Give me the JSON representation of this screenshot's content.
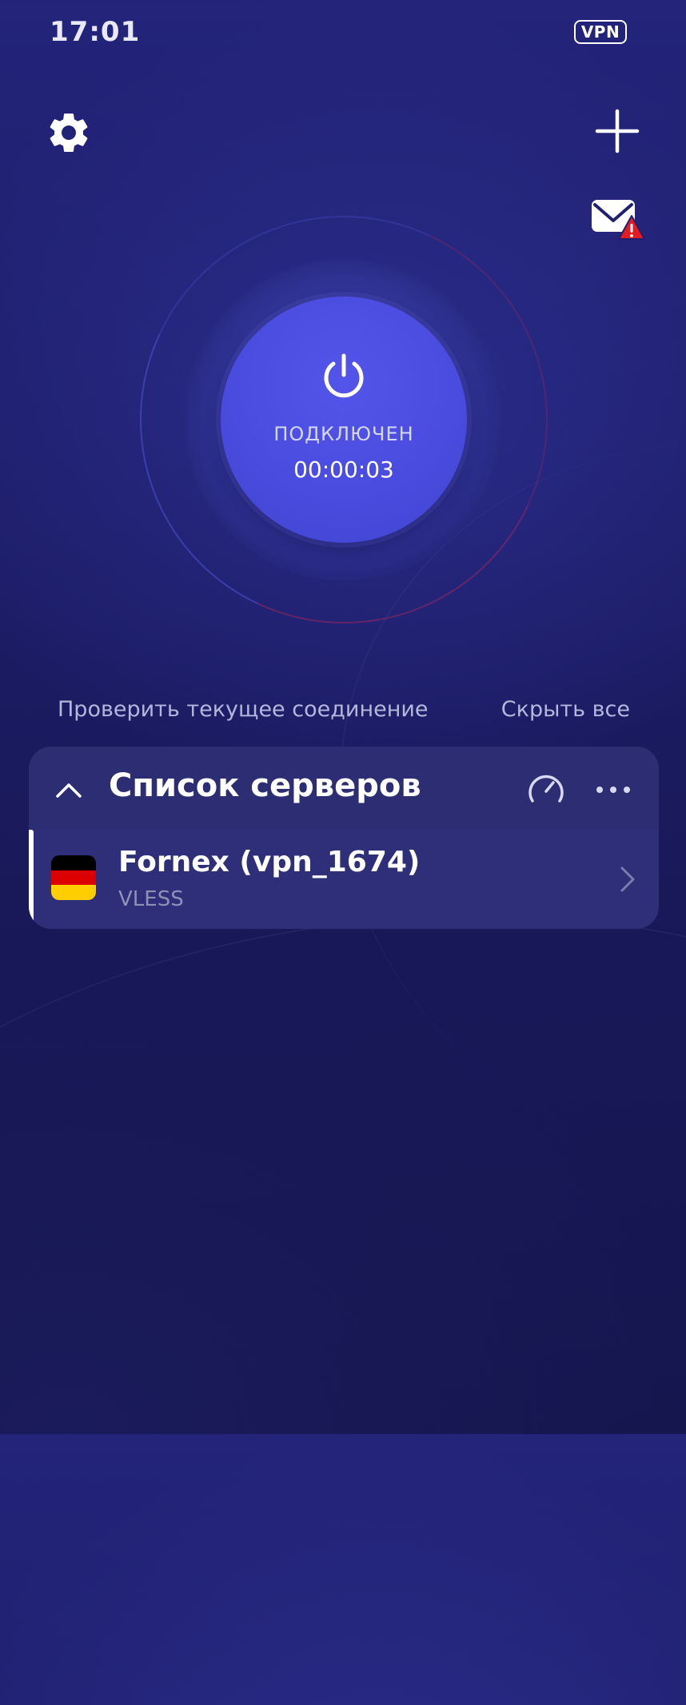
{
  "status_bar": {
    "time": "17:01",
    "vpn_badge": "VPN"
  },
  "toolbar": {
    "settings_icon": "gear-icon",
    "add_icon": "plus-icon",
    "mail_icon": "mail-alert-icon"
  },
  "connection": {
    "status": "ПОДКЛЮЧЕН",
    "timer": "00:00:03"
  },
  "links": {
    "check_connection": "Проверить текущее соединение",
    "hide_all": "Скрыть все"
  },
  "server_list": {
    "title": "Список серверов",
    "servers": [
      {
        "name": "Fornex (vpn_1674)",
        "protocol": "VLESS",
        "flag_colors": [
          "#000000",
          "#dd0000",
          "#ffce00"
        ]
      }
    ]
  },
  "colors": {
    "accent": "#4a4cdf",
    "background": "#1d1d68",
    "panel": "#272868",
    "alert": "#e31b23"
  }
}
